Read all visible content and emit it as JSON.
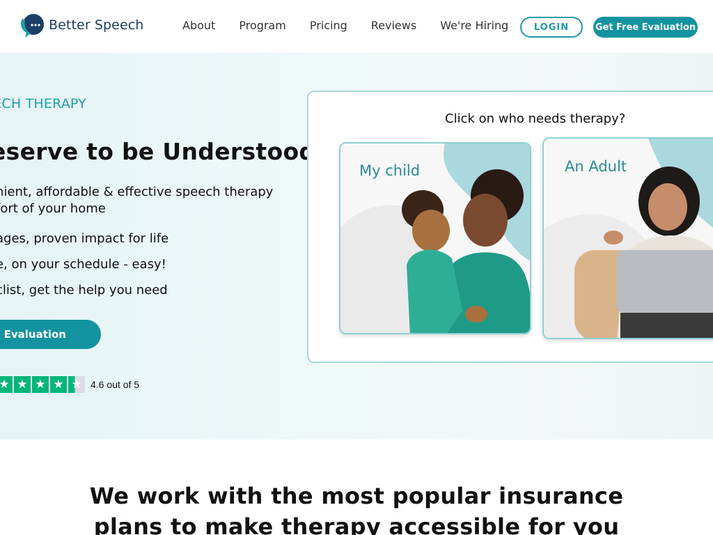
{
  "header": {
    "brand": "Better Speech",
    "nav": [
      "About",
      "Program",
      "Pricing",
      "Reviews",
      "We're Hiring"
    ],
    "login_label": "LOGIN",
    "cta_label": "Get Free Evaluation"
  },
  "hero": {
    "eyebrow": "EECH THERAPY",
    "headline": "eserve to be Understood!",
    "sub_line1": "nient, affordable & effective speech therapy",
    "sub_line2": "fort of your home",
    "bullets": [
      "ages, proven impact for life",
      "e, on your schedule - easy!",
      "clist, get the help you need"
    ],
    "cta_label": "ee Evaluation",
    "rating_value": 4.6,
    "rating_max": 5,
    "rating_text": "4.6 out of 5"
  },
  "selector": {
    "title": "Click on who needs therapy?",
    "options": [
      {
        "label": "My child"
      },
      {
        "label": "An Adult"
      }
    ]
  },
  "insurance": {
    "line1": "We work with the most popular insurance",
    "line2": "plans to make therapy accessible for you"
  },
  "colors": {
    "brand_teal": "#13939f",
    "brand_navy": "#1c3f66",
    "trustpilot_green": "#00b67a"
  }
}
